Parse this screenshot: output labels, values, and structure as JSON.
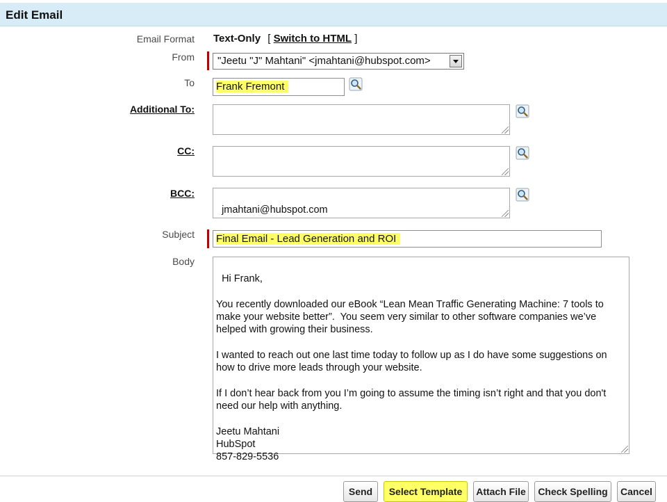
{
  "header": {
    "title": "Edit Email"
  },
  "labels": {
    "email_format": "Email Format",
    "from": "From",
    "to": "To",
    "additional_to": "Additional To:",
    "cc": "CC:",
    "bcc": "BCC:",
    "subject": "Subject",
    "body": "Body"
  },
  "email_format": {
    "value": "Text-Only",
    "bracket_open": "[",
    "switch_link": "Switch to HTML",
    "bracket_close": "]"
  },
  "from": {
    "value": "\"Jeetu \"J\" Mahtani\" <jmahtani@hubspot.com>"
  },
  "to": {
    "value": "Frank Fremont"
  },
  "additional_to": {
    "value": ""
  },
  "cc": {
    "value": ""
  },
  "bcc": {
    "value": "jmahtani@hubspot.com"
  },
  "subject": {
    "value": "Final Email  - Lead Generation and ROI"
  },
  "body": {
    "value": "Hi Frank,\n\nYou recently downloaded our eBook “Lean Mean Traffic Generating Machine: 7 tools to make your website better”.  You seem very similar to other software companies we’ve helped with growing their business.\n\nI wanted to reach out one last time today to follow up as I do have some suggestions on how to drive more leads through your website.\n\nIf I don’t hear back from you I’m going to assume the timing isn’t right and that you don't need our help with anything.\n\nJeetu Mahtani\nHubSpot\n857-829-5536"
  },
  "buttons": {
    "send": "Send",
    "select_template": "Select Template",
    "attach_file": "Attach File",
    "check_spelling": "Check Spelling",
    "cancel": "Cancel"
  },
  "colors": {
    "header_bg": "#d7ecf6",
    "required_bar": "#c00000",
    "highlight": "#ffff66"
  },
  "icons": {
    "lookup": "magnifier-lookup-icon"
  }
}
